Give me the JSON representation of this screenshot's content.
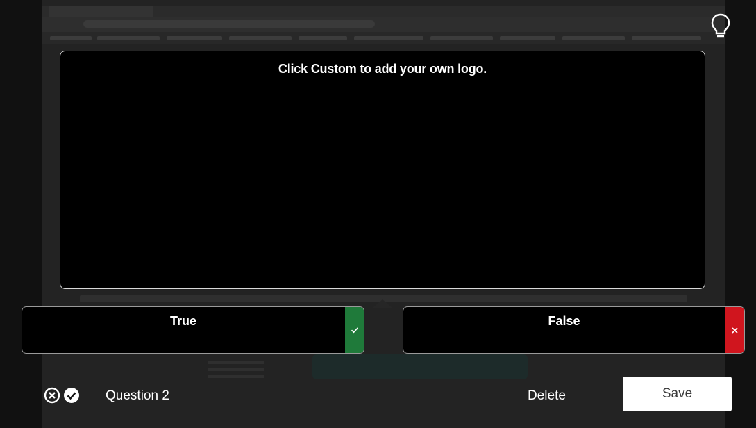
{
  "question": {
    "text": "Click Custom to add your own logo.",
    "label": "Question 2"
  },
  "answers": [
    {
      "label": "True",
      "status": "correct",
      "status_icon": "check-icon",
      "color": "#1f7a3a"
    },
    {
      "label": "False",
      "status": "incorrect",
      "status_icon": "close-icon",
      "color": "#d0151e"
    }
  ],
  "footer": {
    "type_icon": "true-false-icon",
    "delete_label": "Delete",
    "save_label": "Save"
  },
  "toolbar": {
    "hint_icon": "lightbulb-icon"
  },
  "colors": {
    "background": "#111111",
    "card": "#000000",
    "correct": "#1f7a3a",
    "incorrect": "#d0151e"
  }
}
